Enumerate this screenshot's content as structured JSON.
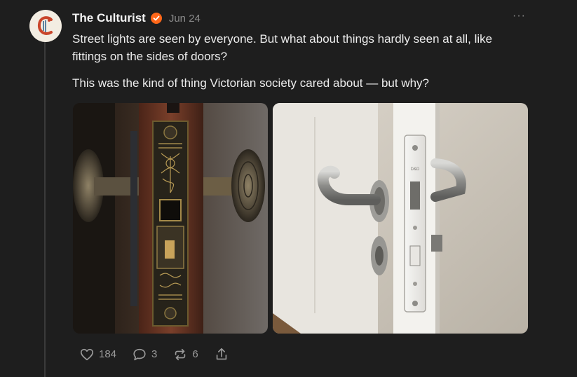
{
  "post": {
    "author": "The Culturist",
    "date": "Jun 24",
    "more_label": "···",
    "paragraphs": [
      "Street lights are seen by everyone. But what about things hardly seen at all, like fittings on the sides of doors?",
      "This was the kind of thing Victorian society cared about — but why?"
    ],
    "media": [
      {
        "icon": "victorian-lock-photo"
      },
      {
        "icon": "modern-lock-photo"
      }
    ],
    "actions": {
      "likes": "184",
      "comments": "3",
      "restacks": "6"
    }
  },
  "colors": {
    "background": "#1e1e1e",
    "verified_badge": "#ff6719",
    "avatar_letter": "#c9452a"
  }
}
